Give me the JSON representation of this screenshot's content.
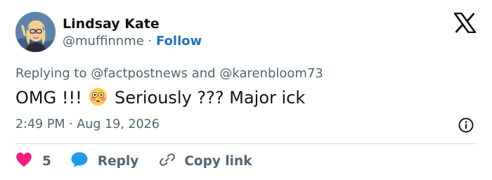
{
  "author": {
    "name": "Lindsay Kate",
    "handle": "@muffinnme",
    "separator": "·",
    "follow_label": "Follow"
  },
  "reply_context": {
    "prefix": "Replying to",
    "mention1": "@factpostnews",
    "conjunction": "and",
    "mention2": "@karenbloom73"
  },
  "tweet": {
    "text_before_emoji": "OMG !!!",
    "emoji": "flushed-face",
    "text_after_emoji": "Seriously ??? Major ick"
  },
  "timestamp": {
    "time": "2:49 PM",
    "separator": "·",
    "date": "Aug 19, 2026"
  },
  "actions": {
    "like_count": "5",
    "reply_label": "Reply",
    "copy_link_label": "Copy link"
  },
  "icons": {
    "platform_logo": "x-logo-icon",
    "info": "info-icon",
    "like": "heart-icon",
    "reply": "speech-bubble-icon",
    "copy_link": "link-icon"
  },
  "colors": {
    "text_primary": "#0f1419",
    "text_secondary": "#536471",
    "follow_link": "#1d74c9",
    "like_red": "#f91880",
    "reply_blue": "#1d9bf0",
    "divider": "#cfd9de"
  }
}
